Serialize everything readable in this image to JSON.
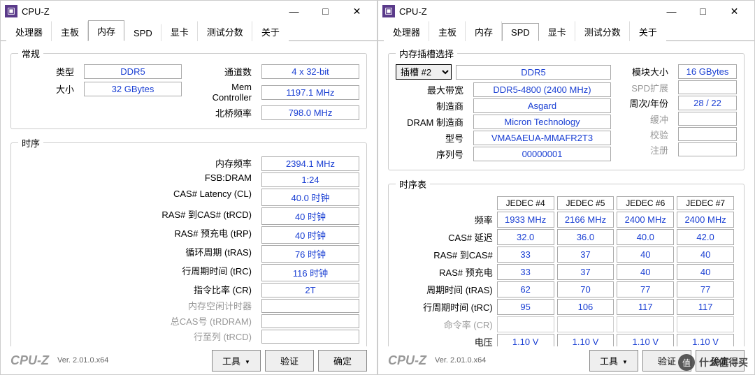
{
  "app": {
    "title": "CPU-Z",
    "brand": "CPU-Z",
    "version": "Ver. 2.01.0.x64"
  },
  "tabs": [
    "处理器",
    "主板",
    "内存",
    "SPD",
    "显卡",
    "测试分数",
    "关于"
  ],
  "left": {
    "activeTab": "内存",
    "general": {
      "legend": "常规",
      "type_label": "类型",
      "type": "DDR5",
      "size_label": "大小",
      "size": "32 GBytes",
      "channels_label": "通道数",
      "channels": "4 x 32-bit",
      "mc_label": "Mem Controller",
      "mc": "1197.1 MHz",
      "nb_label": "北桥频率",
      "nb": "798.0 MHz"
    },
    "timing": {
      "legend": "时序",
      "rows": [
        {
          "label": "内存频率",
          "val": "2394.1 MHz"
        },
        {
          "label": "FSB:DRAM",
          "val": "1:24"
        },
        {
          "label": "CAS# Latency (CL)",
          "val": "40.0 时钟"
        },
        {
          "label": "RAS# 到CAS# (tRCD)",
          "val": "40 时钟"
        },
        {
          "label": "RAS# 预充电 (tRP)",
          "val": "40 时钟"
        },
        {
          "label": "循环周期 (tRAS)",
          "val": "76 时钟"
        },
        {
          "label": "行周期时间 (tRC)",
          "val": "116 时钟"
        },
        {
          "label": "指令比率 (CR)",
          "val": "2T"
        },
        {
          "label": "内存空闲计时器",
          "val": "",
          "gray": true
        },
        {
          "label": "总CAS号 (tRDRAM)",
          "val": "",
          "gray": true
        },
        {
          "label": "行至列 (tRCD)",
          "val": "",
          "gray": true
        }
      ]
    }
  },
  "right": {
    "activeTab": "SPD",
    "slotSelect": {
      "legend": "内存插槽选择",
      "slot_label": "插槽 #2",
      "type": "DDR5",
      "maxbw_label": "最大带宽",
      "maxbw": "DDR5-4800 (2400 MHz)",
      "mfr_label": "制造商",
      "mfr": "Asgard",
      "dram_label": "DRAM 制造商",
      "dram": "Micron Technology",
      "model_label": "型号",
      "model": "VMA5AEUA-MMAFR2T3",
      "serial_label": "序列号",
      "serial": "00000001",
      "modsize_label": "模块大小",
      "modsize": "16 GBytes",
      "spdext_label": "SPD扩展",
      "week_label": "周次/年份",
      "week": "28 / 22",
      "buf_label": "缓冲",
      "chk_label": "校验",
      "reg_label": "注册"
    },
    "tt": {
      "legend": "时序表",
      "cols": [
        "JEDEC #4",
        "JEDEC #5",
        "JEDEC #6",
        "JEDEC #7"
      ],
      "rows": [
        {
          "label": "频率",
          "vals": [
            "1933 MHz",
            "2166 MHz",
            "2400 MHz",
            "2400 MHz"
          ]
        },
        {
          "label": "CAS# 延迟",
          "vals": [
            "32.0",
            "36.0",
            "40.0",
            "42.0"
          ]
        },
        {
          "label": "RAS# 到CAS#",
          "vals": [
            "33",
            "37",
            "40",
            "40"
          ]
        },
        {
          "label": "RAS# 预充电",
          "vals": [
            "33",
            "37",
            "40",
            "40"
          ]
        },
        {
          "label": "周期时间 (tRAS)",
          "vals": [
            "62",
            "70",
            "77",
            "77"
          ]
        },
        {
          "label": "行周期时间 (tRC)",
          "vals": [
            "95",
            "106",
            "117",
            "117"
          ]
        },
        {
          "label": "命令率 (CR)",
          "vals": [
            "",
            "",
            "",
            ""
          ],
          "gray": true
        },
        {
          "label": "电压",
          "vals": [
            "1.10 V",
            "1.10 V",
            "1.10 V",
            "1.10 V"
          ]
        }
      ]
    }
  },
  "footer": {
    "tools": "工具",
    "validate": "验证",
    "ok": "确定"
  },
  "watermark": "什么值得买"
}
